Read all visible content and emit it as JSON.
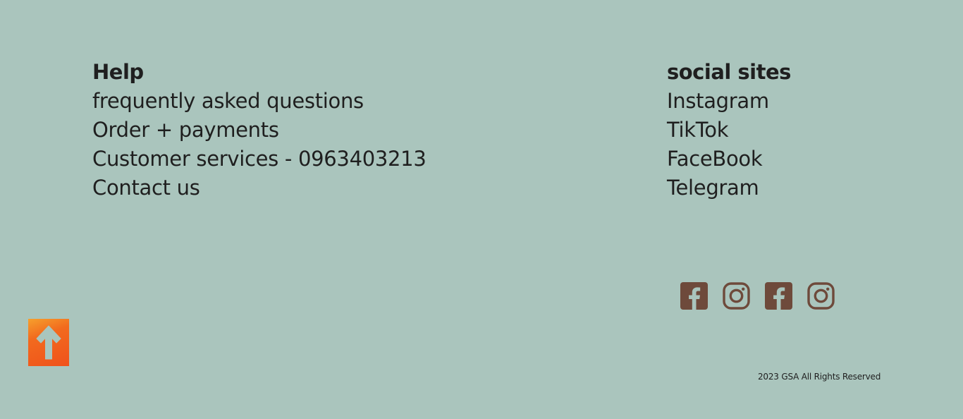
{
  "help": {
    "heading": "Help",
    "links": [
      "frequently asked questions",
      "Order + payments",
      "Customer services - 0963403213",
      "Contact us"
    ]
  },
  "social": {
    "heading": "social sites",
    "links": [
      "Instagram",
      "TikTok",
      "FaceBook",
      "Telegram"
    ],
    "icons": [
      "facebook-icon",
      "instagram-icon",
      "facebook-icon",
      "instagram-icon"
    ]
  },
  "footer": {
    "copyright": "2023 GSA All Rights Reserved"
  },
  "back_to_top": {
    "icon": "arrow-up-icon"
  },
  "colors": {
    "background": "#aac5bd",
    "text": "#1f1f1f",
    "icon_brown": "#6e4a3b",
    "back_to_top_orange": "#f0521b"
  }
}
